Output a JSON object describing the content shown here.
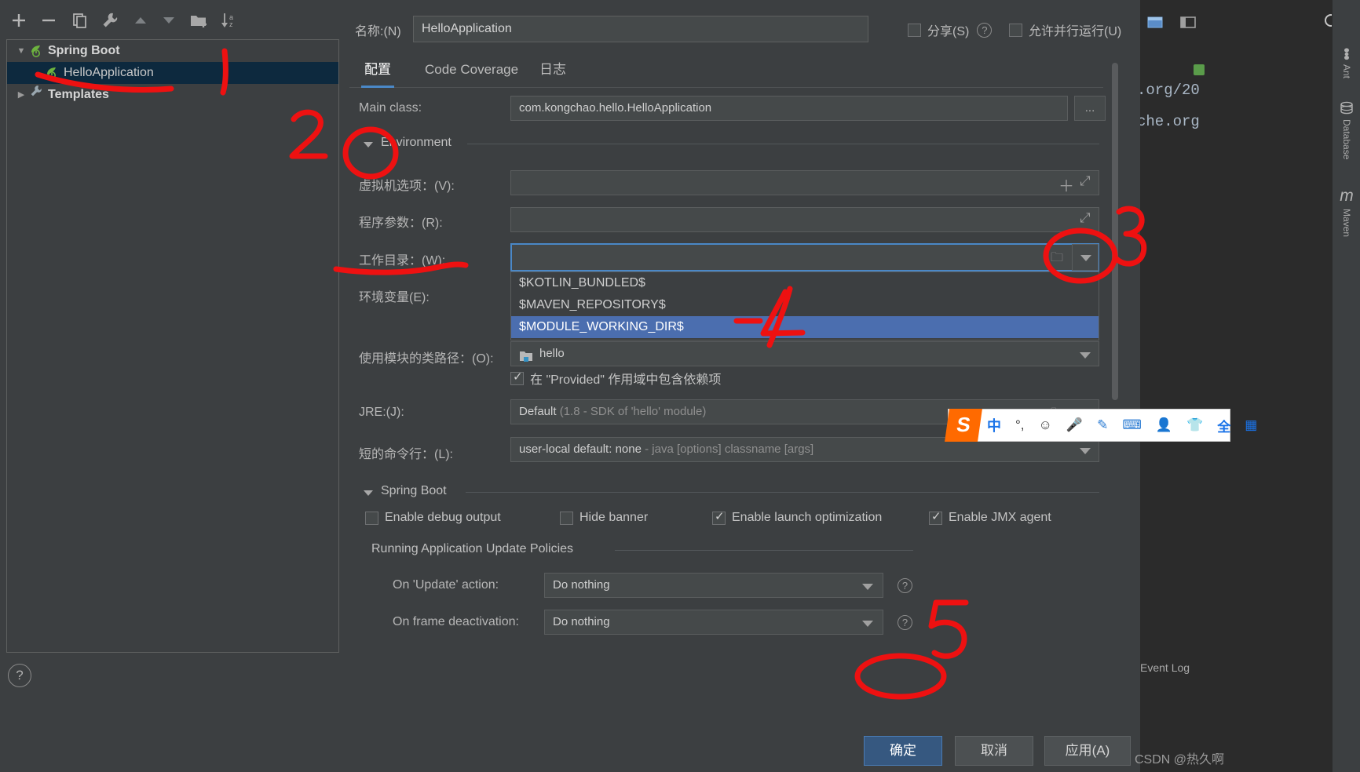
{
  "dialog": {
    "name_label": "名称:(N)",
    "name_value": "HelloApplication",
    "share_label": "分享(S)",
    "allow_parallel_label": "允许并行运行(U)",
    "tabs": [
      {
        "label": "配置",
        "active": true
      },
      {
        "label": "Code Coverage",
        "active": false
      },
      {
        "label": "日志",
        "active": false
      }
    ],
    "fields": {
      "main_class_label": "Main class:",
      "main_class_value": "com.kongchao.hello.HelloApplication",
      "browse_button": "...",
      "environment_group": "Environment",
      "vm_options_label": "虚拟机选项：(V):",
      "vm_options_value": "",
      "program_args_label": "程序参数：(R):",
      "program_args_value": "",
      "working_dir_label": "工作目录：(W):",
      "working_dir_value": "",
      "env_vars_label": "环境变量(E):",
      "env_vars_value": "",
      "module_classpath_label": "使用模块的类路径：(O):",
      "module_classpath_value": "hello",
      "provided_scope_label": "在 \"Provided\" 作用域中包含依赖项",
      "provided_scope_checked": true,
      "jre_label": "JRE:(J):",
      "jre_value": "Default",
      "jre_hint": "(1.8 - SDK of 'hello' module)",
      "shorten_cmdline_label": "短的命令行：(L):",
      "shorten_cmdline_value": "user-local default: none",
      "shorten_cmdline_hint": "- java [options] classname [args]"
    },
    "working_dir_dropdown": {
      "options": [
        "$KOTLIN_BUNDLED$",
        "$MAVEN_REPOSITORY$",
        "$MODULE_WORKING_DIR$"
      ],
      "selected_index": 2
    },
    "spring_boot": {
      "group_title": "Spring Boot",
      "checkboxes": [
        {
          "label": "Enable debug output",
          "checked": false
        },
        {
          "label": "Hide banner",
          "checked": false
        },
        {
          "label": "Enable launch optimization",
          "checked": true
        },
        {
          "label": "Enable JMX agent",
          "checked": true
        }
      ],
      "policies_title": "Running Application Update Policies",
      "on_update_label": "On 'Update' action:",
      "on_update_value": "Do nothing",
      "on_frame_label": "On frame deactivation:",
      "on_frame_value": "Do nothing"
    },
    "buttons": {
      "ok": "确定",
      "cancel": "取消",
      "apply": "应用(A)"
    }
  },
  "tree": {
    "toolbar_icons": [
      "add-icon",
      "remove-icon",
      "copy-icon",
      "wrench-icon",
      "move-up-icon",
      "move-down-icon",
      "new-folder-icon",
      "sort-icon"
    ],
    "nodes": [
      {
        "label": "Spring Boot",
        "level": 0,
        "expanded": true,
        "icon": "spring-boot-icon",
        "selected": false,
        "bold": true
      },
      {
        "label": "HelloApplication",
        "level": 1,
        "expanded": null,
        "icon": "spring-boot-icon",
        "selected": true,
        "bold": false
      },
      {
        "label": "Templates",
        "level": 0,
        "expanded": false,
        "icon": "wrench-icon",
        "selected": false,
        "bold": true
      }
    ],
    "help_icon": "?"
  },
  "editor": {
    "line1": ".org/20",
    "line2": "che.org"
  },
  "right_toolbar": {
    "items": [
      {
        "label": "Ant",
        "icon": "ant-icon"
      },
      {
        "label": "Database",
        "icon": "database-icon"
      },
      {
        "label": "Maven",
        "icon": "maven-icon"
      }
    ],
    "top_icons": [
      "restore-window-icon",
      "minimize-window-icon",
      "search-icon"
    ]
  },
  "ime": {
    "logo": "S",
    "items": [
      {
        "label": "中",
        "name": "chinese-mode-icon"
      },
      {
        "label": "°,",
        "name": "punctuation-icon"
      },
      {
        "label": "☺",
        "name": "emoji-icon"
      },
      {
        "label": "🎤",
        "name": "voice-input-icon"
      },
      {
        "label": "✎",
        "name": "handwriting-icon"
      },
      {
        "label": "⌨",
        "name": "soft-keyboard-icon"
      },
      {
        "label": "👤",
        "name": "user-icon"
      },
      {
        "label": "👕",
        "name": "skin-icon"
      },
      {
        "label": "全",
        "name": "toolbox-icon"
      },
      {
        "label": "▦",
        "name": "menu-icon"
      }
    ]
  },
  "status": {
    "event_log": "Event Log",
    "watermark": "CSDN @热久啊"
  },
  "annotations": {
    "marks": [
      "1",
      "2",
      "3",
      "4",
      "5"
    ],
    "color": "#ee1111"
  },
  "colors": {
    "accent": "#4b6eaf",
    "primary_button": "#365880",
    "selection": "#0d293e",
    "background": "#3c3f41",
    "annotation_red": "#ee1111"
  }
}
